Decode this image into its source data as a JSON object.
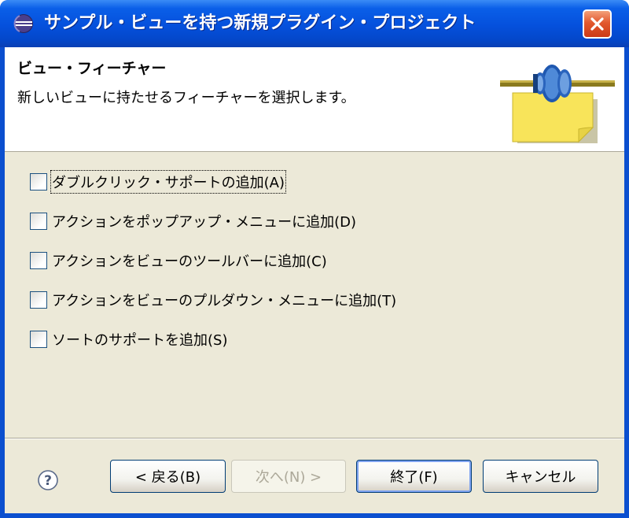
{
  "window": {
    "title": "サンプル・ビューを持つ新規プラグイン・プロジェクト",
    "icon": "eclipse-icon",
    "close": "close-icon"
  },
  "banner": {
    "title": "ビュー・フィーチャー",
    "description": "新しいビューに持たせるフィーチャーを選択します。",
    "image": "plugin-wizard-image"
  },
  "options": [
    {
      "label": "ダブルクリック・サポートの追加(A)",
      "checked": false
    },
    {
      "label": "アクションをポップアップ・メニューに追加(D)",
      "checked": false
    },
    {
      "label": "アクションをビューのツールバーに追加(C)",
      "checked": false
    },
    {
      "label": "アクションをビューのプルダウン・メニューに追加(T)",
      "checked": false
    },
    {
      "label": "ソートのサポートを追加(S)",
      "checked": false
    }
  ],
  "buttons": {
    "help": "help-icon",
    "back": "< 戻る(B)",
    "next": "次へ(N) >",
    "finish": "終了(F)",
    "cancel": "キャンセル"
  },
  "colors": {
    "titlebar": "#0550dc",
    "client": "#ece9d8",
    "close": "#e2582e"
  }
}
